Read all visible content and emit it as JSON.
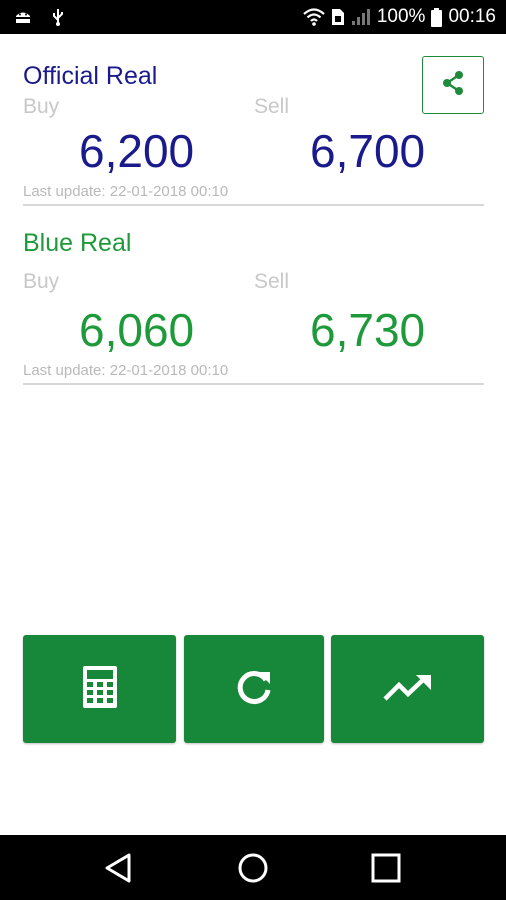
{
  "status_bar": {
    "battery": "100%",
    "time": "00:16",
    "icons": [
      "android-debug-icon",
      "usb-icon",
      "wifi-icon",
      "sim-icon",
      "signal-icon",
      "battery-icon"
    ]
  },
  "sections": [
    {
      "title": "Official Real",
      "buy_label": "Buy",
      "sell_label": "Sell",
      "buy_value": "6,200",
      "sell_value": "6,700",
      "last_update": "Last update: 22-01-2018 00:10",
      "color": "#1a1a8c"
    },
    {
      "title": "Blue Real",
      "buy_label": "Buy",
      "sell_label": "Sell",
      "buy_value": "6,060",
      "sell_value": "6,730",
      "last_update": "Last update: 22-01-2018 00:10",
      "color": "#1e9a3a"
    }
  ],
  "actions": {
    "share_icon": "share-icon",
    "calculator_icon": "calculator-icon",
    "refresh_icon": "refresh-icon",
    "chart_icon": "trending-up-icon",
    "button_color": "#17883a"
  },
  "nav_bar": {
    "icons": [
      "back-icon",
      "home-icon",
      "recents-icon"
    ]
  }
}
